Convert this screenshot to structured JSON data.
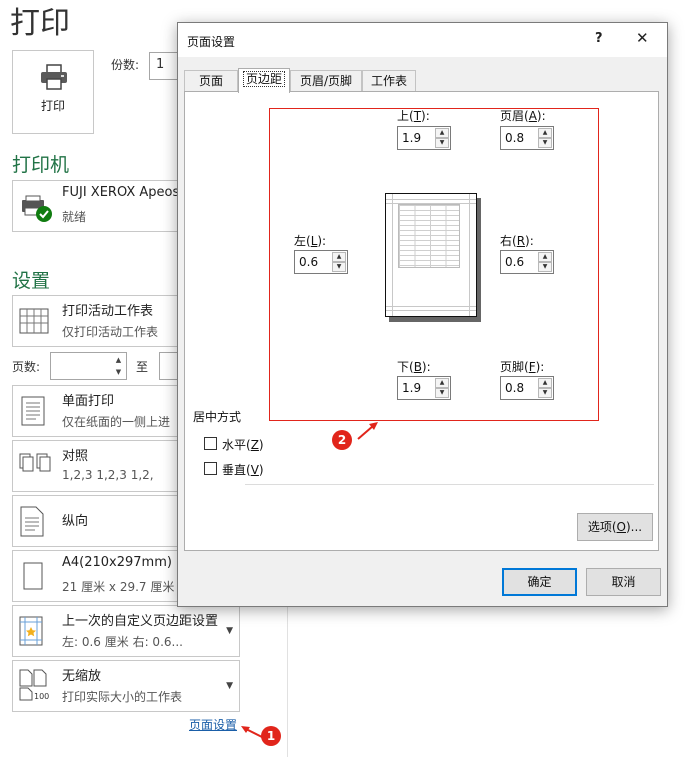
{
  "backstage": {
    "title": "打印",
    "print_button_label": "打印",
    "copies_label": "份数:",
    "copies_value": "1",
    "printer_heading": "打印机",
    "printer_name": "FUJI XEROX Apeos",
    "printer_status": "就绪",
    "settings_heading": "设置",
    "setting_active": {
      "title": "打印活动工作表",
      "desc": "仅打印活动工作表"
    },
    "pages_label": "页数:",
    "pages_to": "至",
    "setting_sided": {
      "title": "单面打印",
      "desc": "仅在纸面的一侧上进"
    },
    "setting_collate": {
      "title": "对照",
      "desc": "1,2,3    1,2,3    1,2,"
    },
    "setting_orientation": {
      "title": "纵向"
    },
    "setting_paper": {
      "title": "A4(210x297mm)",
      "desc": "21 厘米 x 29.7 厘米"
    },
    "setting_margins": {
      "title": "上一次的自定义页边距设置",
      "desc": "左:  0.6 厘米     右:  0.6..."
    },
    "setting_scaling": {
      "title": "无缩放",
      "desc": "打印实际大小的工作表",
      "icon_text": "100"
    },
    "page_setup_link": "页面设置",
    "badge1": "1"
  },
  "dialog": {
    "title": "页面设置",
    "help": "?",
    "close": "✕",
    "tabs": [
      "页面",
      "页边距",
      "页眉/页脚",
      "工作表"
    ],
    "active_tab": "页边距",
    "top_label": {
      "text": "上(",
      "key": "T",
      "end": "):"
    },
    "top_value": "1.9",
    "header_label": {
      "text": "页眉(",
      "key": "A",
      "end": "):"
    },
    "header_value": "0.8",
    "left_label": {
      "text": "左(",
      "key": "L",
      "end": "):"
    },
    "left_value": "0.6",
    "right_label": {
      "text": "右(",
      "key": "R",
      "end": "):"
    },
    "right_value": "0.6",
    "bottom_label": {
      "text": "下(",
      "key": "B",
      "end": "):"
    },
    "bottom_value": "1.9",
    "footer_label": {
      "text": "页脚(",
      "key": "F",
      "end": "):"
    },
    "footer_value": "0.8",
    "center_heading": "居中方式",
    "horizontal": {
      "text": "水平(",
      "key": "Z",
      "end": ")"
    },
    "vertical": {
      "text": "垂直(",
      "key": "V",
      "end": ")"
    },
    "options_button": {
      "text": "选项(",
      "key": "O",
      "end": ")..."
    },
    "ok_button": "确定",
    "cancel_button": "取消",
    "badge2": "2"
  },
  "colors": {
    "accent_green": "#217346",
    "annotation_red": "#e1251b",
    "focus_blue": "#0078d7",
    "link_blue": "#1a5ea8"
  }
}
